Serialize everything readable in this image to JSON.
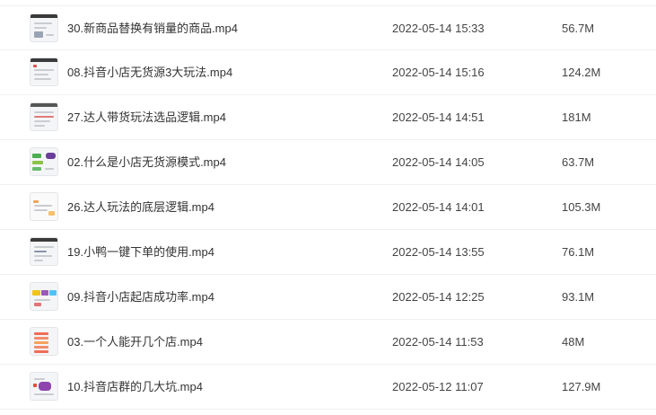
{
  "files": [
    {
      "name": "30.新商品替换有销量的商品.mp4",
      "date": "2022-05-14 15:33",
      "size": "56.7M",
      "thumb_accent": "#9aa4b5",
      "thumb_icon": "video-thumbnail-icon"
    },
    {
      "name": "08.抖音小店无货源3大玩法.mp4",
      "date": "2022-05-14 15:16",
      "size": "124.2M",
      "thumb_accent": "#d9534f",
      "thumb_icon": "video-thumbnail-icon"
    },
    {
      "name": "27.达人带货玩法选品逻辑.mp4",
      "date": "2022-05-14 14:51",
      "size": "181M",
      "thumb_accent": "#e07a7a",
      "thumb_icon": "video-thumbnail-icon"
    },
    {
      "name": "02.什么是小店无货源模式.mp4",
      "date": "2022-05-14 14:05",
      "size": "63.7M",
      "thumb_accent": "#4caf50",
      "thumb_icon": "video-thumbnail-icon"
    },
    {
      "name": "26.达人玩法的底层逻辑.mp4",
      "date": "2022-05-14 14:01",
      "size": "105.3M",
      "thumb_accent": "#f0a35e",
      "thumb_icon": "video-thumbnail-icon"
    },
    {
      "name": "19.小鸭一键下单的使用.mp4",
      "date": "2022-05-14 13:55",
      "size": "76.1M",
      "thumb_accent": "#8a94a6",
      "thumb_icon": "video-thumbnail-icon"
    },
    {
      "name": "09.抖音小店起店成功率.mp4",
      "date": "2022-05-14 12:25",
      "size": "93.1M",
      "thumb_accent": "#9b59b6",
      "thumb_icon": "video-thumbnail-icon"
    },
    {
      "name": "03.一个人能开几个店.mp4",
      "date": "2022-05-14 11:53",
      "size": "48M",
      "thumb_accent": "#ef6c57",
      "thumb_icon": "video-thumbnail-icon"
    },
    {
      "name": "10.抖音店群的几大坑.mp4",
      "date": "2022-05-12 11:07",
      "size": "127.9M",
      "thumb_accent": "#8e44ad",
      "thumb_icon": "video-thumbnail-icon"
    }
  ]
}
